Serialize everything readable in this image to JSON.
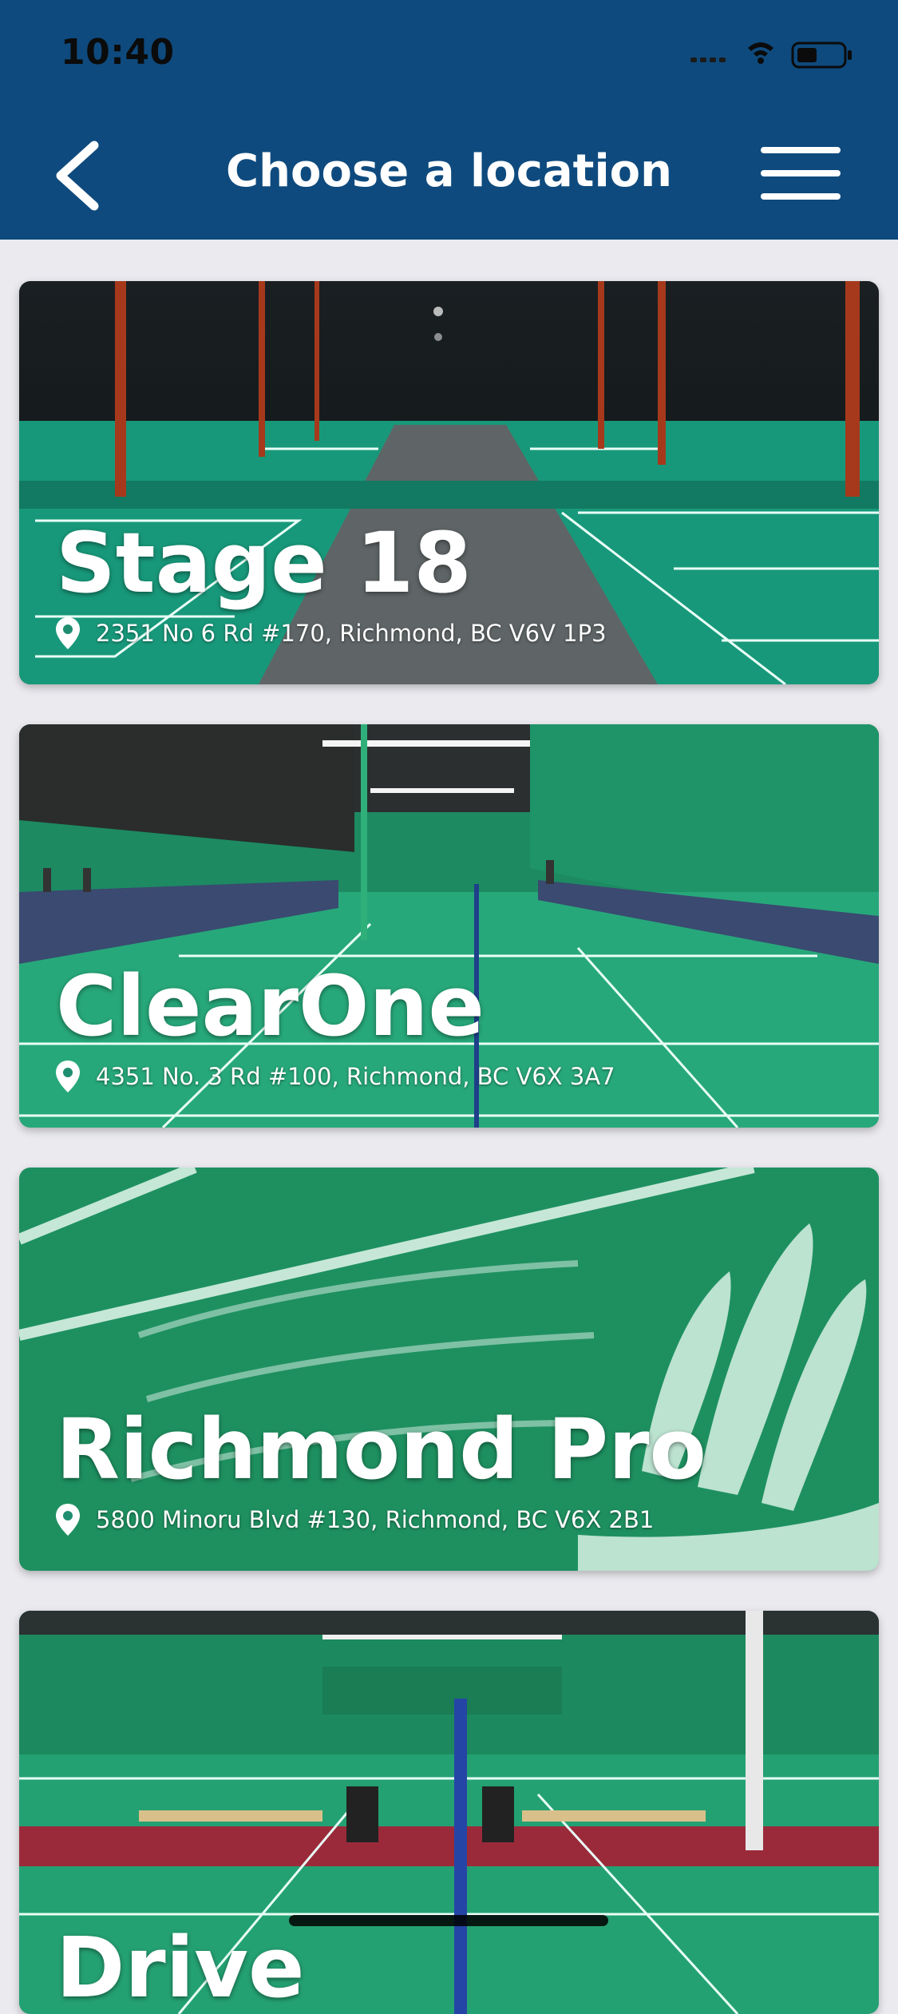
{
  "status_bar": {
    "time": "10:40"
  },
  "header": {
    "title": "Choose a location"
  },
  "locations": [
    {
      "name": "Stage 18",
      "address": "2351 No 6 Rd #170, Richmond, BC V6V 1P3"
    },
    {
      "name": "ClearOne",
      "address": "4351 No. 3 Rd #100, Richmond, BC V6X 3A7"
    },
    {
      "name": "Richmond Pro",
      "address": "5800 Minoru Blvd #130, Richmond, BC V6X 2B1"
    },
    {
      "name": "Drive",
      "address": ""
    }
  ],
  "colors": {
    "header": "#0e4a7d",
    "court_green": "#1f9a75",
    "background": "#ebeaef"
  },
  "icons": [
    "back-chevron-icon",
    "hamburger-menu-icon",
    "location-pin-icon",
    "wifi-icon",
    "battery-icon",
    "signal-icon"
  ]
}
